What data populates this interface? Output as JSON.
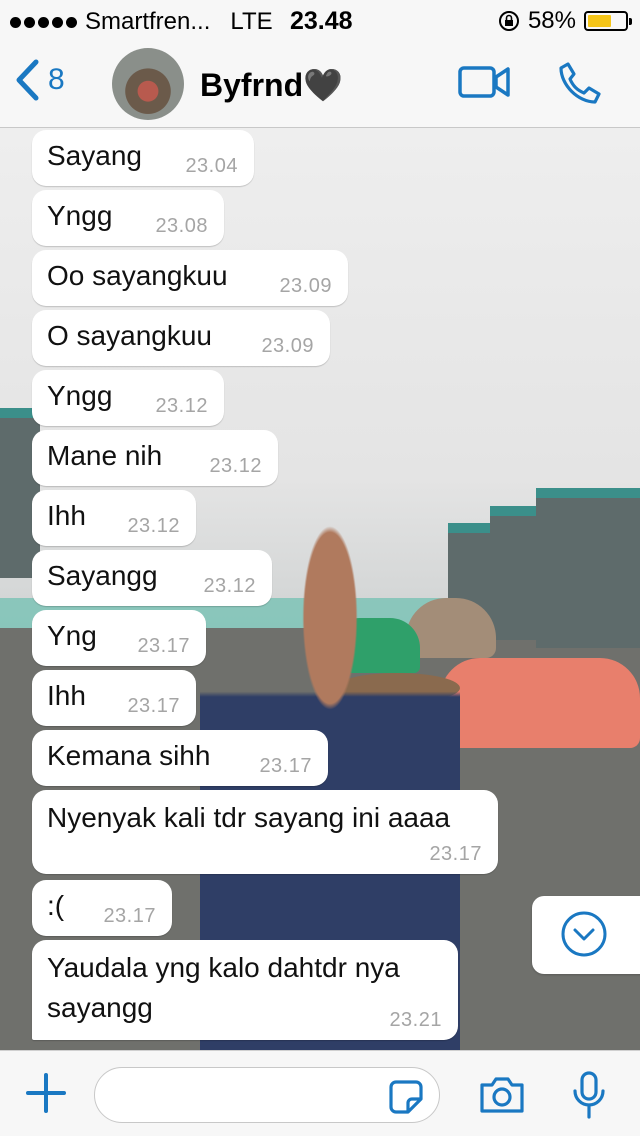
{
  "status_bar": {
    "carrier": "Smartfren...",
    "network": "LTE",
    "time": "23.48",
    "battery": "58%",
    "battery_level": 0.58,
    "battery_color": "#f5c518",
    "icons": [
      "signal-dots-icon",
      "rotation-lock-icon",
      "battery-icon"
    ]
  },
  "header": {
    "back_count": "8",
    "contact_name": "Byfrnd🖤",
    "icons": [
      "back-chevron-icon",
      "video-call-icon",
      "phone-icon"
    ],
    "accent_color": "#1a78c2"
  },
  "messages": [
    {
      "text": "Sayang",
      "time": "23.04"
    },
    {
      "text": "Yngg",
      "time": "23.08"
    },
    {
      "text": "Oo sayangkuu",
      "time": "23.09"
    },
    {
      "text": "O sayangkuu",
      "time": "23.09"
    },
    {
      "text": "Yngg",
      "time": "23.12"
    },
    {
      "text": "Mane nih",
      "time": "23.12"
    },
    {
      "text": "Ihh",
      "time": "23.12"
    },
    {
      "text": "Sayangg",
      "time": "23.12"
    },
    {
      "text": "Yng",
      "time": "23.17"
    },
    {
      "text": "Ihh",
      "time": "23.17"
    },
    {
      "text": "Kemana sihh",
      "time": "23.17"
    },
    {
      "text": "Nyenyak kali tdr sayang ini aaaa",
      "time": "23.17"
    },
    {
      "text": ":(",
      "time": "23.17"
    },
    {
      "text": "Yaudala yng kalo dahtdr nya sayangg",
      "time": "23.21"
    }
  ],
  "input_bar": {
    "placeholder": "",
    "icons": [
      "plus-icon",
      "sticker-icon",
      "camera-icon",
      "microphone-icon"
    ]
  },
  "scroll_button": {
    "icon": "chevron-down-circle-icon"
  }
}
